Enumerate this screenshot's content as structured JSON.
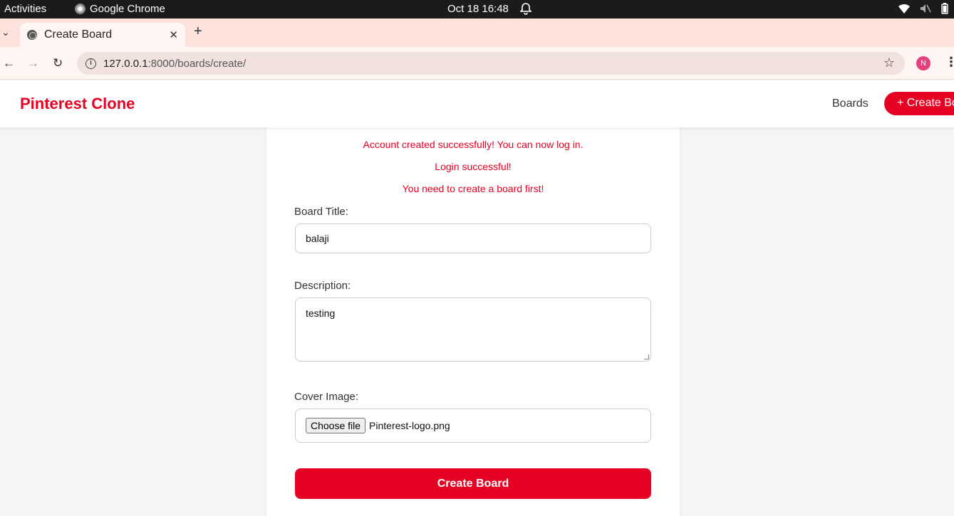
{
  "os": {
    "activities": "Activities",
    "app_name": "Google Chrome",
    "clock": "Oct 18  16:48"
  },
  "browser": {
    "tab_title": "Create Board",
    "url_host": "127.0.0.1",
    "url_path": ":8000/boards/create/",
    "profile_initial": "N"
  },
  "site": {
    "logo": "Pinterest Clone",
    "nav_boards": "Boards",
    "create_button": "+ Create Board"
  },
  "messages": [
    "Account created successfully! You can now log in.",
    "Login successful!",
    "You need to create a board first!"
  ],
  "form": {
    "title_label": "Board Title:",
    "title_value": "balaji",
    "description_label": "Description:",
    "description_value": "testing",
    "cover_label": "Cover Image:",
    "choose_file": "Choose file",
    "file_name": "Pinterest-logo.png",
    "submit": "Create Board"
  },
  "colors": {
    "brand": "#e60023",
    "tab_strip": "#fde3dc"
  }
}
